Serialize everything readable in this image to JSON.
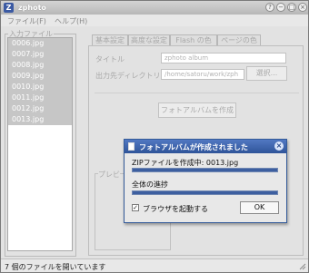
{
  "window": {
    "title": "zphoto",
    "app_icon": "Z"
  },
  "menu": {
    "file": "ファイル(F)",
    "help": "ヘルプ(H)"
  },
  "input_files": {
    "legend": "入力ファイル",
    "files": [
      "0006.jpg",
      "0007.jpg",
      "0008.jpg",
      "0009.jpg",
      "0010.jpg",
      "0011.jpg",
      "0012.jpg",
      "0013.jpg"
    ]
  },
  "tabs": [
    "基本設定",
    "高度な設定",
    "Flash の色",
    "ページの色"
  ],
  "form": {
    "title_label": "タイトル",
    "title_value": "zphoto album",
    "output_dir_label": "出力先ディレクトリ",
    "output_dir_value": "/home/satoru/work/zph",
    "select_button": "選択...",
    "create_button": "フォトアルバムを作成",
    "preview_label": "プレビ"
  },
  "status": {
    "text": "7 個のファイルを開いています"
  },
  "dialog": {
    "title": "フォトアルバムが作成されました",
    "progress_label": "ZIPファイルを作成中: 0013.jpg",
    "progress_value": 1.0,
    "overall_label": "全体の進捗",
    "overall_value": 1.0,
    "checkbox_label": "ブラウザを起動する",
    "checkbox_checked": true,
    "ok_label": "OK"
  }
}
